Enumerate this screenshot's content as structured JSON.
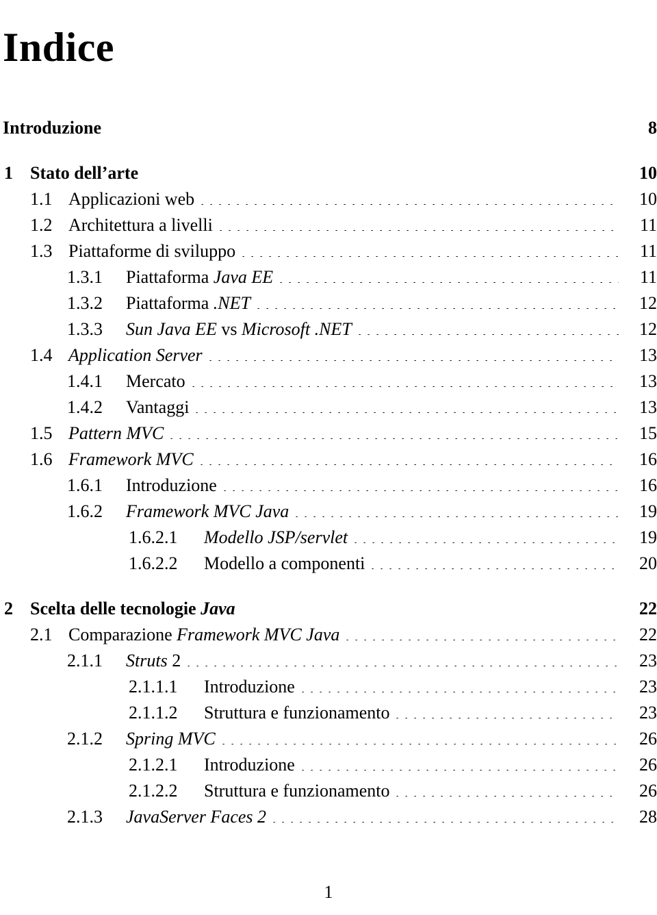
{
  "document": {
    "title": "Indice",
    "folio": "1"
  },
  "toc": {
    "entries": [
      {
        "level": "front",
        "number": "",
        "page": "8",
        "bold": true,
        "leader": false,
        "runs": [
          {
            "text": "Introduzione",
            "style": "roman"
          }
        ]
      },
      {
        "level": 0,
        "number": "1",
        "page": "10",
        "bold": true,
        "leader": false,
        "gap_before": true,
        "runs": [
          {
            "text": "Stato dell’arte",
            "style": "roman"
          }
        ]
      },
      {
        "level": 1,
        "number": "1.1",
        "page": "10",
        "bold": false,
        "leader": true,
        "runs": [
          {
            "text": "Applicazioni web",
            "style": "roman"
          }
        ]
      },
      {
        "level": 1,
        "number": "1.2",
        "page": "11",
        "bold": false,
        "leader": true,
        "runs": [
          {
            "text": "Architettura a livelli",
            "style": "roman"
          }
        ]
      },
      {
        "level": 1,
        "number": "1.3",
        "page": "11",
        "bold": false,
        "leader": true,
        "runs": [
          {
            "text": "Piattaforme di sviluppo",
            "style": "roman"
          }
        ]
      },
      {
        "level": 2,
        "number": "1.3.1",
        "page": "11",
        "bold": false,
        "leader": true,
        "runs": [
          {
            "text": "Piattaforma ",
            "style": "roman"
          },
          {
            "text": "Java EE",
            "style": "italic"
          }
        ]
      },
      {
        "level": 2,
        "number": "1.3.2",
        "page": "12",
        "bold": false,
        "leader": true,
        "runs": [
          {
            "text": "Piattaforma ",
            "style": "roman"
          },
          {
            "text": ".NET",
            "style": "italic"
          }
        ]
      },
      {
        "level": 2,
        "number": "1.3.3",
        "page": "12",
        "bold": false,
        "leader": true,
        "runs": [
          {
            "text": "Sun Java EE",
            "style": "italic"
          },
          {
            "text": " vs ",
            "style": "roman"
          },
          {
            "text": "Microsoft .NET",
            "style": "italic"
          }
        ]
      },
      {
        "level": 1,
        "number": "1.4",
        "page": "13",
        "bold": false,
        "leader": true,
        "runs": [
          {
            "text": "Application Server",
            "style": "italic"
          }
        ]
      },
      {
        "level": 2,
        "number": "1.4.1",
        "page": "13",
        "bold": false,
        "leader": true,
        "runs": [
          {
            "text": "Mercato",
            "style": "roman"
          }
        ]
      },
      {
        "level": 2,
        "number": "1.4.2",
        "page": "13",
        "bold": false,
        "leader": true,
        "runs": [
          {
            "text": "Vantaggi",
            "style": "roman"
          }
        ]
      },
      {
        "level": 1,
        "number": "1.5",
        "page": "15",
        "bold": false,
        "leader": true,
        "runs": [
          {
            "text": "Pattern MVC",
            "style": "italic"
          }
        ]
      },
      {
        "level": 1,
        "number": "1.6",
        "page": "16",
        "bold": false,
        "leader": true,
        "runs": [
          {
            "text": "Framework MVC",
            "style": "italic"
          }
        ]
      },
      {
        "level": 2,
        "number": "1.6.1",
        "page": "16",
        "bold": false,
        "leader": true,
        "runs": [
          {
            "text": "Introduzione",
            "style": "roman"
          }
        ]
      },
      {
        "level": 2,
        "number": "1.6.2",
        "page": "19",
        "bold": false,
        "leader": true,
        "runs": [
          {
            "text": "Framework MVC Java",
            "style": "italic"
          }
        ]
      },
      {
        "level": 3,
        "number": "1.6.2.1",
        "page": "19",
        "bold": false,
        "leader": true,
        "runs": [
          {
            "text": "Modello JSP/servlet",
            "style": "italic"
          }
        ]
      },
      {
        "level": 3,
        "number": "1.6.2.2",
        "page": "20",
        "bold": false,
        "leader": true,
        "runs": [
          {
            "text": "Modello a componenti",
            "style": "roman"
          }
        ]
      },
      {
        "level": 0,
        "number": "2",
        "page": "22",
        "bold": true,
        "leader": false,
        "gap_before": true,
        "runs": [
          {
            "text": "Scelta delle tecnologie ",
            "style": "roman"
          },
          {
            "text": "Java",
            "style": "italic"
          }
        ]
      },
      {
        "level": 1,
        "number": "2.1",
        "page": "22",
        "bold": false,
        "leader": true,
        "runs": [
          {
            "text": "Comparazione ",
            "style": "roman"
          },
          {
            "text": "Framework MVC Java",
            "style": "italic"
          }
        ]
      },
      {
        "level": 2,
        "number": "2.1.1",
        "page": "23",
        "bold": false,
        "leader": true,
        "runs": [
          {
            "text": "Struts",
            "style": "italic"
          },
          {
            "text": " 2",
            "style": "roman"
          }
        ]
      },
      {
        "level": 3,
        "number": "2.1.1.1",
        "page": "23",
        "bold": false,
        "leader": true,
        "runs": [
          {
            "text": "Introduzione",
            "style": "roman"
          }
        ]
      },
      {
        "level": 3,
        "number": "2.1.1.2",
        "page": "23",
        "bold": false,
        "leader": true,
        "runs": [
          {
            "text": "Struttura e funzionamento",
            "style": "roman"
          }
        ]
      },
      {
        "level": 2,
        "number": "2.1.2",
        "page": "26",
        "bold": false,
        "leader": true,
        "runs": [
          {
            "text": "Spring MVC",
            "style": "italic"
          }
        ]
      },
      {
        "level": 3,
        "number": "2.1.2.1",
        "page": "26",
        "bold": false,
        "leader": true,
        "runs": [
          {
            "text": "Introduzione",
            "style": "roman"
          }
        ]
      },
      {
        "level": 3,
        "number": "2.1.2.2",
        "page": "26",
        "bold": false,
        "leader": true,
        "runs": [
          {
            "text": "Struttura e funzionamento",
            "style": "roman"
          }
        ]
      },
      {
        "level": 2,
        "number": "2.1.3",
        "page": "28",
        "bold": false,
        "leader": true,
        "runs": [
          {
            "text": "JavaServer Faces 2",
            "style": "italic"
          }
        ]
      }
    ]
  }
}
